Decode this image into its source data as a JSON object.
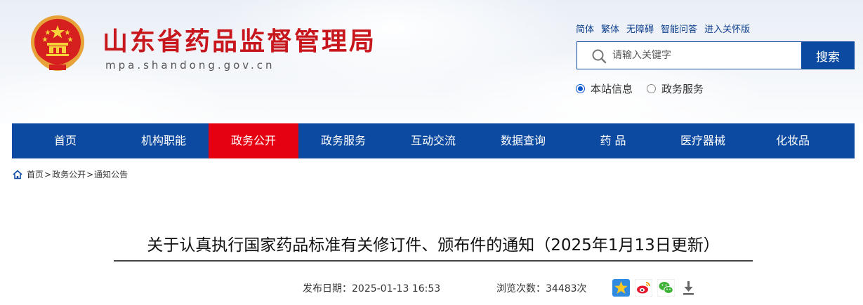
{
  "header": {
    "site_title": "山东省药品监督管理局",
    "site_domain": "mpa.shandong.gov.cn",
    "top_links": [
      "简体",
      "繁体",
      "无障碍",
      "智能问答",
      "进入关怀版"
    ],
    "search": {
      "placeholder": "请输入关键字",
      "button_label": "搜索"
    },
    "scope_options": [
      {
        "label": "本站信息",
        "selected": true
      },
      {
        "label": "政务服务",
        "selected": false
      }
    ]
  },
  "nav": {
    "items": [
      {
        "label": "首页",
        "active": false
      },
      {
        "label": "机构职能",
        "active": false
      },
      {
        "label": "政务公开",
        "active": true
      },
      {
        "label": "政务服务",
        "active": false
      },
      {
        "label": "互动交流",
        "active": false
      },
      {
        "label": "数据查询",
        "active": false
      },
      {
        "label": "药 品",
        "active": false
      },
      {
        "label": "医疗器械",
        "active": false
      },
      {
        "label": "化妆品",
        "active": false
      }
    ]
  },
  "breadcrumb": {
    "items": [
      "首页",
      "政务公开",
      "通知公告"
    ],
    "separator": ">"
  },
  "article": {
    "title": "关于认真执行国家药品标准有关修订件、颁布件的通知（2025年1月13日更新）",
    "date_label": "发布日期：",
    "date_value": "2025-01-13 16:53",
    "views_label": "浏览次数：",
    "views_value": "34483次",
    "share_icons": [
      "qzone-star-icon",
      "weibo-icon",
      "wechat-icon",
      "download-icon"
    ]
  },
  "colors": {
    "brand_blue": "#0b4aa0",
    "active_red": "#e50012",
    "title_red": "#c8161d"
  }
}
